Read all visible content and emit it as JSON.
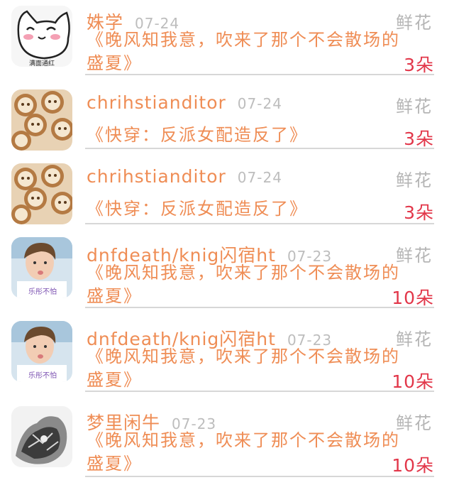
{
  "records": [
    {
      "user": "姝学",
      "date": "07-24",
      "gift_label": "鲜花",
      "book": "《晚风知我意，吹来了那个不会散场的盛夏》",
      "count": "3朵",
      "avatar_icon": "cartoon-cat-avatar-icon"
    },
    {
      "user": "chrihstianditor",
      "date": "07-24",
      "gift_label": "鲜花",
      "book": "《快穿：反派女配造反了》",
      "count": "3朵",
      "avatar_icon": "latte-art-avatar-icon"
    },
    {
      "user": "chrihstianditor",
      "date": "07-24",
      "gift_label": "鲜花",
      "book": "《快穿：反派女配造反了》",
      "count": "3朵",
      "avatar_icon": "latte-art-avatar-icon"
    },
    {
      "user": "dnfdeath/knig闪宿ht",
      "date": "07-23",
      "gift_label": "鲜花",
      "book": "《晚风知我意，吹来了那个不会散场的盛夏》",
      "count": "10朵",
      "avatar_icon": "person-photo-avatar-icon"
    },
    {
      "user": "dnfdeath/knig闪宿ht",
      "date": "07-23",
      "gift_label": "鲜花",
      "book": "《晚风知我意，吹来了那个不会散场的盛夏》",
      "count": "10朵",
      "avatar_icon": "person-photo-avatar-icon"
    },
    {
      "user": "梦里闲牛",
      "date": "07-23",
      "gift_label": "鲜花",
      "book": "《晚风知我意，吹来了那个不会散场的盛夏》",
      "count": "10朵",
      "avatar_icon": "sketch-art-avatar-icon"
    }
  ],
  "avatar_captions": {
    "cat": "满面通红",
    "person": "乐彤不怕"
  }
}
